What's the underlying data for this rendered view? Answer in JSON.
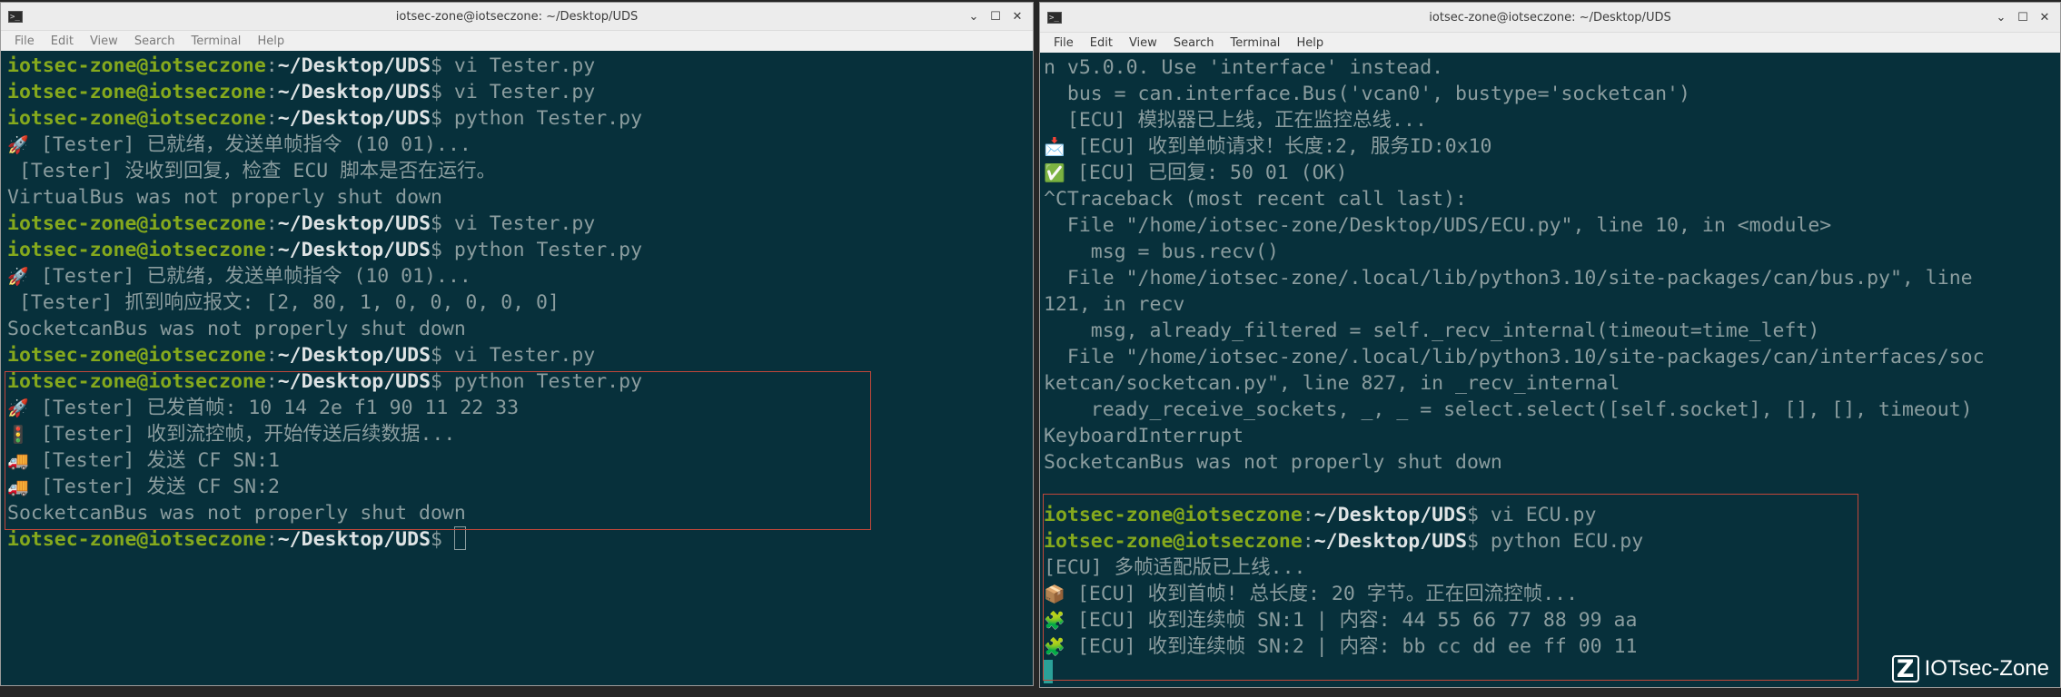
{
  "left_window": {
    "title": "iotsec-zone@iotseczone: ~/Desktop/UDS",
    "menu": [
      "File",
      "Edit",
      "View",
      "Search",
      "Terminal",
      "Help"
    ],
    "lines": [
      {
        "user": "iotsec-zone@iotseczone",
        "path": "~/Desktop/UDS",
        "dollar": "$ ",
        "cmd": "vi Tester.py"
      },
      {
        "user": "iotsec-zone@iotseczone",
        "path": "~/Desktop/UDS",
        "dollar": "$ ",
        "cmd": "vi Tester.py"
      },
      {
        "user": "iotsec-zone@iotseczone",
        "path": "~/Desktop/UDS",
        "dollar": "$ ",
        "cmd": "python Tester.py"
      },
      {
        "icon": "🚀",
        "icon_name": "rocket-icon",
        "text": " [Tester] 已就绪，发送单帧指令 (10 01)..."
      },
      {
        "text": " [Tester] 没收到回复，检查 ECU 脚本是否在运行。"
      },
      {
        "text": "VirtualBus was not properly shut down"
      },
      {
        "user": "iotsec-zone@iotseczone",
        "path": "~/Desktop/UDS",
        "dollar": "$ ",
        "cmd": "vi Tester.py"
      },
      {
        "user": "iotsec-zone@iotseczone",
        "path": "~/Desktop/UDS",
        "dollar": "$ ",
        "cmd": "python Tester.py"
      },
      {
        "icon": "🚀",
        "icon_name": "rocket-icon",
        "text": " [Tester] 已就绪，发送单帧指令 (10 01)..."
      },
      {
        "text": " [Tester] 抓到响应报文: [2, 80, 1, 0, 0, 0, 0, 0]"
      },
      {
        "text": "SocketcanBus was not properly shut down"
      },
      {
        "user": "iotsec-zone@iotseczone",
        "path": "~/Desktop/UDS",
        "dollar": "$ ",
        "cmd": "vi Tester.py"
      },
      {
        "user": "iotsec-zone@iotseczone",
        "path": "~/Desktop/UDS",
        "dollar": "$ ",
        "cmd": "python Tester.py"
      },
      {
        "icon": "🚀",
        "icon_name": "rocket-icon",
        "text": " [Tester] 已发首帧: 10 14 2e f1 90 11 22 33"
      },
      {
        "icon": "🚦",
        "icon_name": "traffic-light-icon",
        "text": " [Tester] 收到流控帧，开始传送后续数据..."
      },
      {
        "icon": "🚚",
        "icon_name": "truck-icon",
        "text": " [Tester] 发送 CF SN:1"
      },
      {
        "icon": "🚚",
        "icon_name": "truck-icon",
        "text": " [Tester] 发送 CF SN:2"
      },
      {
        "text": "SocketcanBus was not properly shut down"
      },
      {
        "user": "iotsec-zone@iotseczone",
        "path": "~/Desktop/UDS",
        "dollar": "$ ",
        "cmd": "",
        "cursor": "outline"
      }
    ]
  },
  "right_window": {
    "title": "iotsec-zone@iotseczone: ~/Desktop/UDS",
    "menu": [
      "File",
      "Edit",
      "View",
      "Search",
      "Terminal",
      "Help"
    ],
    "lines": [
      {
        "text": "n v5.0.0. Use 'interface' instead."
      },
      {
        "text": "  bus = can.interface.Bus('vcan0', bustype='socketcan')"
      },
      {
        "text": "  [ECU] 模拟器已上线，正在监控总线..."
      },
      {
        "icon": "📩",
        "icon_name": "incoming-envelope-icon",
        "text": " [ECU] 收到单帧请求！长度:2, 服务ID:0x10"
      },
      {
        "icon": "✅",
        "icon_name": "check-mark-icon",
        "text": " [ECU] 已回复: 50 01 (OK)"
      },
      {
        "text": "^CTraceback (most recent call last):"
      },
      {
        "text": "  File \"/home/iotsec-zone/Desktop/UDS/ECU.py\", line 10, in <module>"
      },
      {
        "text": "    msg = bus.recv()"
      },
      {
        "text": "  File \"/home/iotsec-zone/.local/lib/python3.10/site-packages/can/bus.py\", line"
      },
      {
        "text": "121, in recv"
      },
      {
        "text": "    msg, already_filtered = self._recv_internal(timeout=time_left)"
      },
      {
        "text": "  File \"/home/iotsec-zone/.local/lib/python3.10/site-packages/can/interfaces/soc"
      },
      {
        "text": "ketcan/socketcan.py\", line 827, in _recv_internal"
      },
      {
        "text": "    ready_receive_sockets, _, _ = select.select([self.socket], [], [], timeout)"
      },
      {
        "text": "KeyboardInterrupt"
      },
      {
        "text": "SocketcanBus was not properly shut down"
      },
      {
        "text": ""
      },
      {
        "user": "iotsec-zone@iotseczone",
        "path": "~/Desktop/UDS",
        "dollar": "$ ",
        "cmd": "vi ECU.py"
      },
      {
        "user": "iotsec-zone@iotseczone",
        "path": "~/Desktop/UDS",
        "dollar": "$ ",
        "cmd": "python ECU.py"
      },
      {
        "text": "[ECU] 多帧适配版已上线..."
      },
      {
        "icon": "📦",
        "icon_name": "package-icon",
        "text": " [ECU] 收到首帧! 总长度: 20 字节。正在回流控帧..."
      },
      {
        "icon": "🧩",
        "icon_name": "puzzle-piece-icon",
        "text": " [ECU] 收到连续帧 SN:1 | 内容: 44 55 66 77 88 99 aa"
      },
      {
        "icon": "🧩",
        "icon_name": "puzzle-piece-icon",
        "text": " [ECU] 收到连续帧 SN:2 | 内容: bb cc dd ee ff 00 11"
      },
      {
        "text": "",
        "cursor": "block"
      }
    ]
  },
  "watermark": {
    "logo_letter": "Z",
    "text": "IOTsec-Zone"
  }
}
